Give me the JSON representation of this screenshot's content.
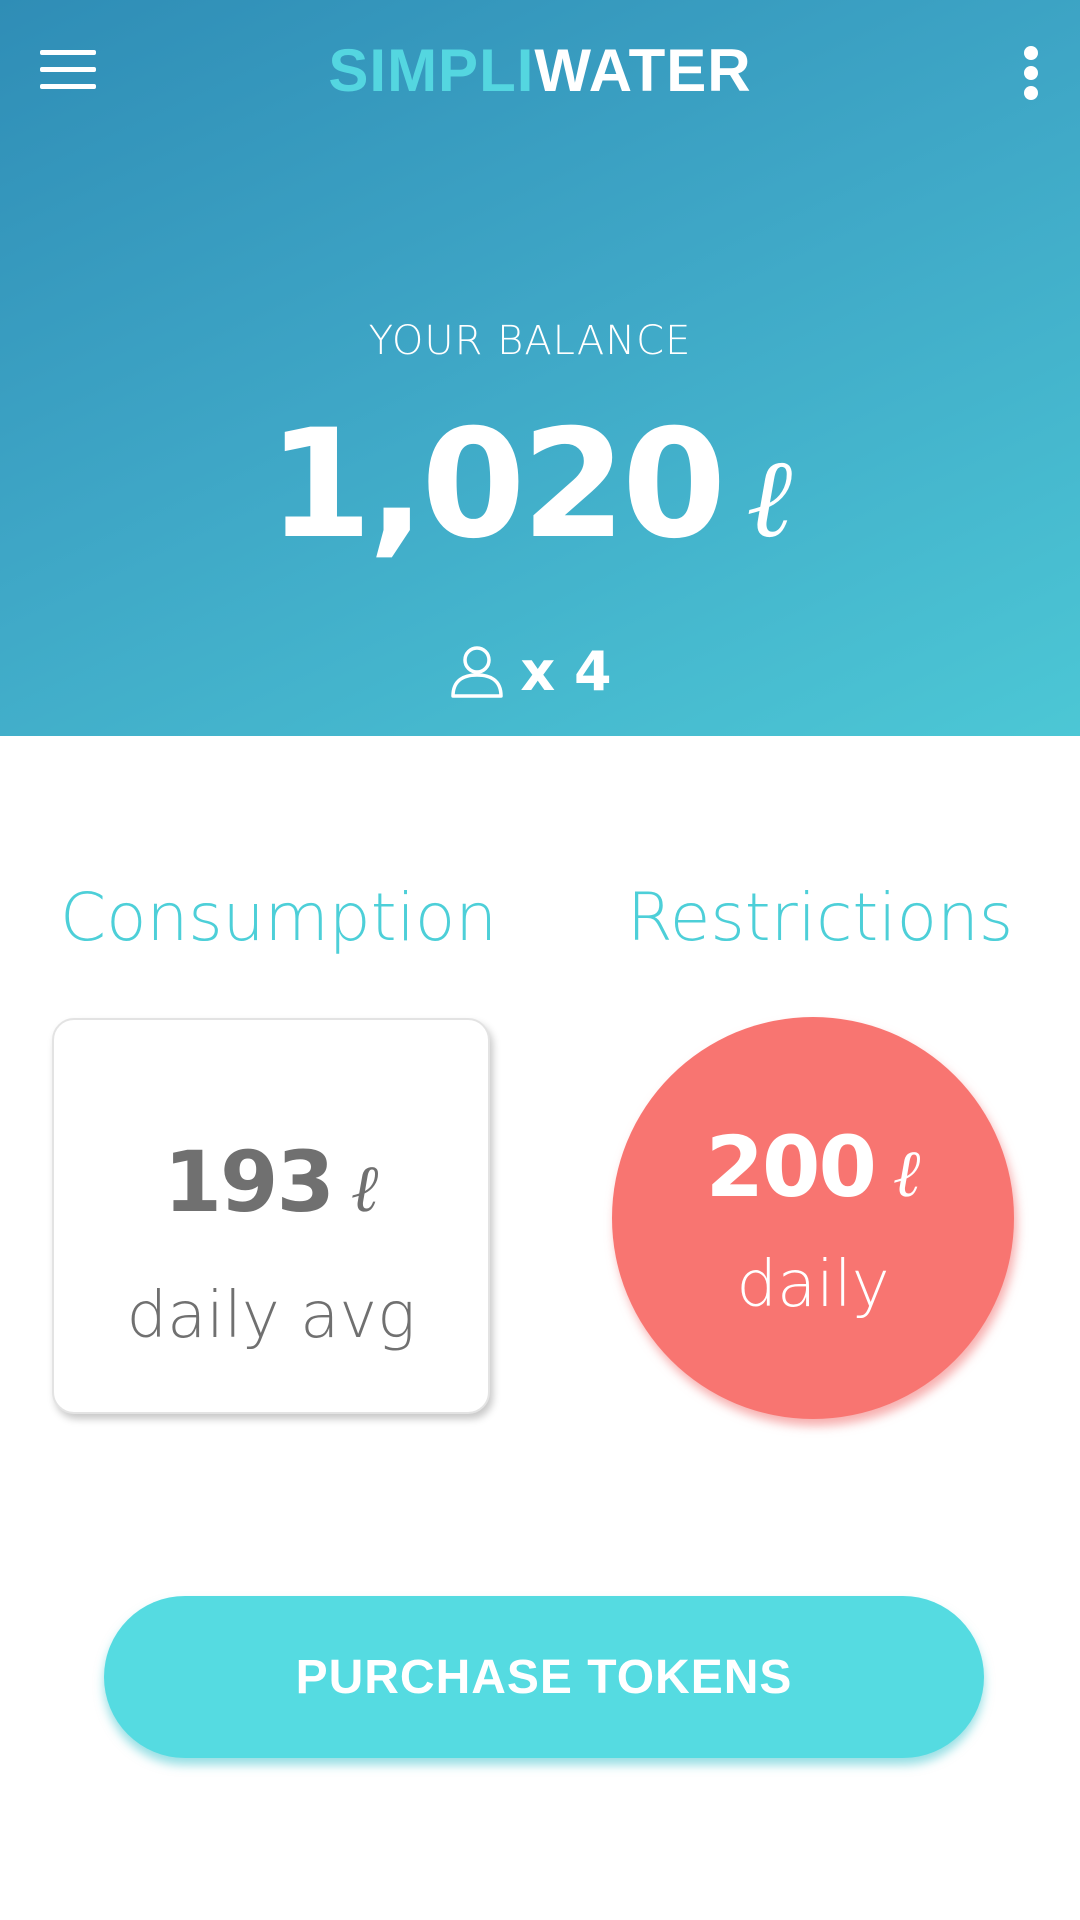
{
  "header": {
    "title_part1": "SIMPLI",
    "title_part2": "WATER",
    "menu_icon": "hamburger-menu-icon",
    "overflow_icon": "more-vertical-icon"
  },
  "balance": {
    "label": "YOUR BALANCE",
    "value": "1,020",
    "unit": "ℓ",
    "members_icon": "user-icon",
    "members_count": "x 4"
  },
  "consumption": {
    "heading": "Consumption",
    "value": "193",
    "unit": "ℓ",
    "label": "daily avg"
  },
  "restrictions": {
    "heading": "Restrictions",
    "value": "200",
    "unit": "ℓ",
    "label": "daily"
  },
  "actions": {
    "purchase_label": "PURCHASE TOKENS"
  },
  "colors": {
    "accent": "#55dbe1",
    "header_gradient_start": "#2f8db6",
    "header_gradient_end": "#4cc7d5",
    "restriction": "#f87571",
    "text_gray": "#707070"
  }
}
